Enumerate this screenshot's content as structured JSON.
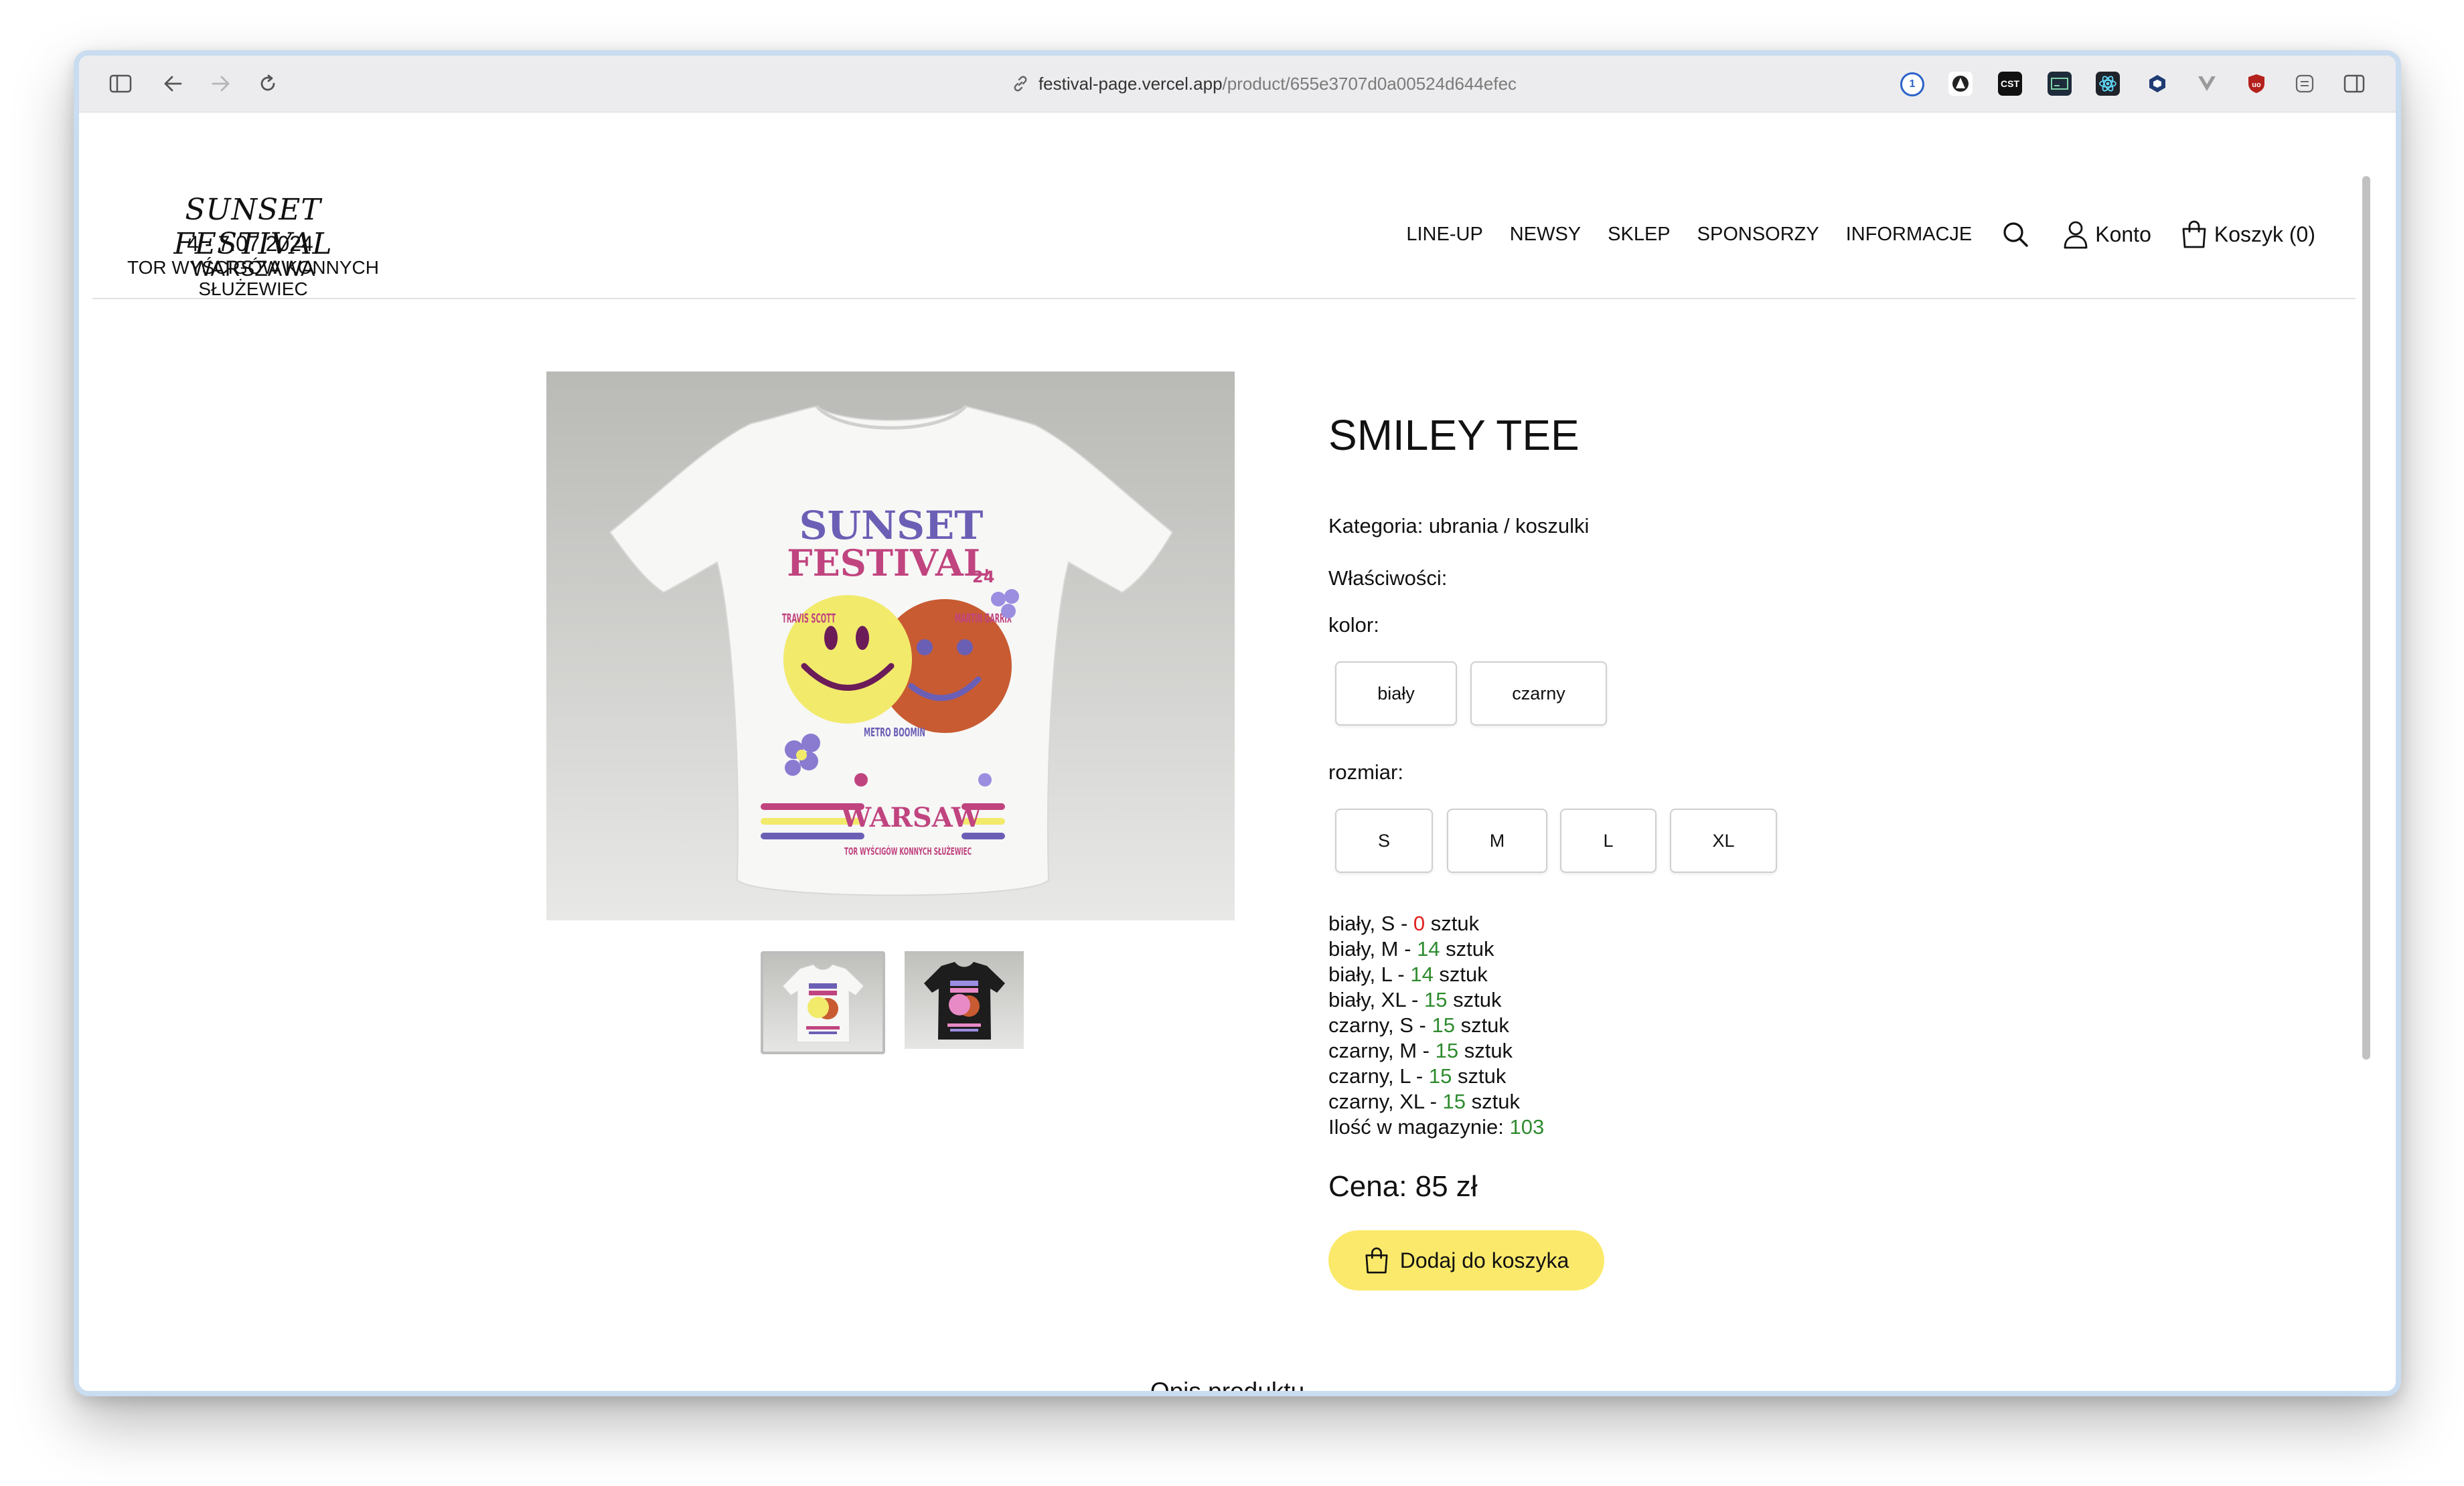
{
  "browser": {
    "url_host": "festival-page.vercel.app",
    "url_path": "/product/655e3707d0a00524d644efec"
  },
  "header": {
    "logo_title": "SUNSET FESTIVAL",
    "logo_date": "4 - 7.07.2024, WARSZAWA",
    "logo_venue": "TOR WYŚCIGÓW KONNYCH SŁUŻEWIEC",
    "nav": [
      "LINE-UP",
      "NEWSY",
      "SKLEP",
      "SPONSORZY",
      "INFORMACJE"
    ],
    "account_label": "Konto",
    "cart_label": "Koszyk (0)"
  },
  "tee_print": {
    "line1": "SUNSET",
    "line2": "FESTIVAL",
    "year": "24",
    "artist_left": "TRAVIS SCOTT",
    "artist_right": "MARTIN GARRIX",
    "artist_middle": "METRO BOOMIN",
    "city": "WARSAW",
    "venue": "TOR WYŚCIGÓW KONNYCH SŁUŻEWIEC"
  },
  "product": {
    "title": "SMILEY TEE",
    "category": "Kategoria: ubrania / koszulki",
    "properties_label": "Właściwości:",
    "color_label": "kolor:",
    "colors": [
      "biały",
      "czarny"
    ],
    "size_label": "rozmiar:",
    "sizes": [
      "S",
      "M",
      "L",
      "XL"
    ],
    "stock_rows": [
      {
        "label": "biały, S - ",
        "qty": "0",
        "unit": " sztuk"
      },
      {
        "label": "biały, M - ",
        "qty": "14",
        "unit": " sztuk"
      },
      {
        "label": "biały, L - ",
        "qty": "14",
        "unit": " sztuk"
      },
      {
        "label": "biały, XL - ",
        "qty": "15",
        "unit": " sztuk"
      },
      {
        "label": "czarny, S - ",
        "qty": "15",
        "unit": " sztuk"
      },
      {
        "label": "czarny, M - ",
        "qty": "15",
        "unit": " sztuk"
      },
      {
        "label": "czarny, L - ",
        "qty": "15",
        "unit": " sztuk"
      },
      {
        "label": "czarny, XL - ",
        "qty": "15",
        "unit": " sztuk"
      }
    ],
    "total_label": "Ilość w magazynie: ",
    "total_qty": "103",
    "price": "Cena: 85 zł",
    "add_to_cart": "Dodaj do koszyka",
    "description_heading": "Opis produktu"
  },
  "colors": {
    "accent_yellow": "#fbe96b",
    "stock_green": "#2e8b2e",
    "stock_red": "#e22020"
  }
}
